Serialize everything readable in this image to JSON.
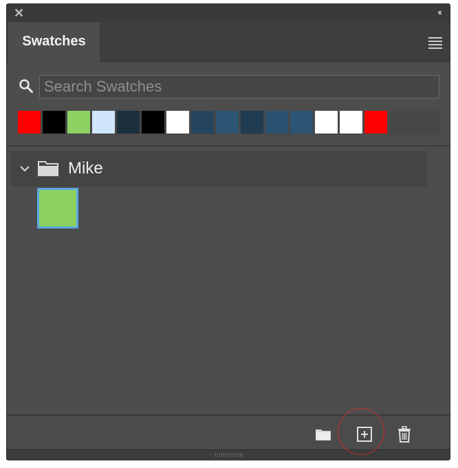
{
  "panel": {
    "tab_label": "Swatches",
    "close_glyph": "✕",
    "collapse_glyph": "‹‹"
  },
  "search": {
    "placeholder": "Search Swatches",
    "value": ""
  },
  "recent_swatches": [
    "#ff0000",
    "#000000",
    "#8ed162",
    "#cfe6fb",
    "#1b2f3d",
    "#000000",
    "#ffffff",
    "#24455d",
    "#2c5574",
    "#1f3c51",
    "#2a5271",
    "#2c5574",
    "#ffffff",
    "#ffffff",
    "#ff0000"
  ],
  "group": {
    "name": "Mike",
    "expanded": true,
    "swatches": [
      "#8ed162"
    ]
  },
  "colors": {
    "panel_bg": "#4d4d4d",
    "selection_border": "#5aa8e6",
    "annotation_circle": "#c3312e"
  },
  "icons": {
    "close": "close-icon",
    "collapse": "collapse-icon",
    "menu": "panel-menu-icon",
    "search": "search-icon",
    "chevron": "chevron-down-icon",
    "folder": "folder-icon",
    "new_group": "new-folder-icon",
    "new_swatch": "new-swatch-icon",
    "delete": "trash-icon"
  }
}
